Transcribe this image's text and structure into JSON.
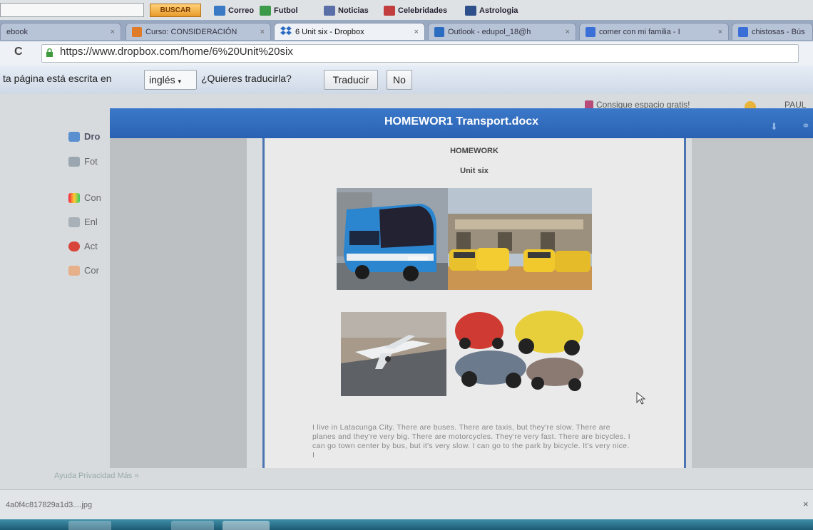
{
  "bookmarks": {
    "search_button": "BUSCAR",
    "items": [
      "Correo",
      "Futbol",
      "Noticias",
      "Celebridades",
      "Astrologia"
    ]
  },
  "tabs": [
    {
      "label": "ebook",
      "close": "×"
    },
    {
      "label": "Curso: CONSIDERACIÓN",
      "close": "×"
    },
    {
      "label": "6 Unit six - Dropbox",
      "close": "×"
    },
    {
      "label": "Outlook - edupol_18@h",
      "close": "×"
    },
    {
      "label": "comer con mi familia - I",
      "close": "×"
    },
    {
      "label": "chistosas - Bús",
      "close": ""
    }
  ],
  "address": {
    "reload": "C",
    "url": "https://www.dropbox.com/home/6%20Unit%20six"
  },
  "translate_bar": {
    "prompt": "ta página está escrita en",
    "language": "inglés",
    "question": "¿Quieres traducirla?",
    "translate_button": "Traducir",
    "no_button": "No"
  },
  "dropbox": {
    "promo": "Consigue espacio gratis!",
    "user": "PAUL",
    "sidebar": [
      "Dro",
      "Fot",
      "Con",
      "Enl",
      "Act",
      "Cor"
    ],
    "footer": "Ayuda  Privacidad  Más  »"
  },
  "preview": {
    "title": "HOMEWOR1 Transport.docx",
    "heading": "HOMEWORK",
    "subheading": "Unit six",
    "body": "I live in Latacunga City. There are buses. There are taxis, but they're slow. There are planes and they're very big. There are motorcycles. They're very fast. There are bicycles. I can go          town center by bus, but it's very slow. I can go to the park by bicycle. It's very nice. I"
  },
  "downloads": {
    "file": "4a0f4c817829a1d3....jpg",
    "close": "×"
  },
  "colors": {
    "modal_header": "#2f69bb",
    "doc_border": "#4b74b3",
    "taskbar": "#2a7391"
  }
}
